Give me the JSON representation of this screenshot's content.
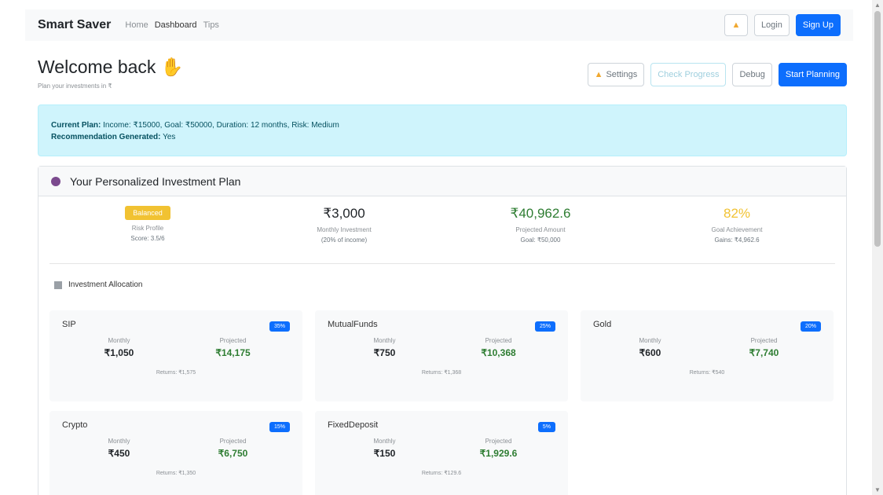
{
  "nav": {
    "brand": "Smart Saver",
    "links": [
      "Home",
      "Dashboard",
      "Tips"
    ],
    "login": "Login",
    "signup": "Sign Up"
  },
  "header": {
    "title": "Welcome back",
    "subtitle": "Plan your investments in ₹",
    "buttons": {
      "settings": "Settings",
      "check_progress": "Check Progress",
      "debug": "Debug",
      "start_planning": "Start Planning"
    }
  },
  "alert": {
    "plan_label": "Current Plan:",
    "plan_text": " Income: ₹15000, Goal: ₹50000, Duration: 12 months, Risk: Medium",
    "rec_label": "Recommendation Generated:",
    "rec_text": " Yes"
  },
  "plan": {
    "title": "Your Personalized Investment Plan",
    "stats": [
      {
        "badge": "Balanced",
        "label": "Risk Profile",
        "small": "Score: 3.5/6"
      },
      {
        "big": "₹3,000",
        "label": "Monthly Investment",
        "small": "(20% of income)"
      },
      {
        "big": "₹40,962.6",
        "label": "Projected Amount",
        "small": "Goal: ₹50,000"
      },
      {
        "big": "82%",
        "label": "Goal Achievement",
        "small": "Gains: ₹4,962.6"
      }
    ]
  },
  "allocation": {
    "title": "Investment Allocation",
    "monthly_label": "Monthly",
    "projected_label": "Projected",
    "items": [
      {
        "name": "SIP",
        "pct": "35%",
        "monthly": "₹1,050",
        "projected": "₹14,175",
        "returns": "Returns: ₹1,575"
      },
      {
        "name": "MutualFunds",
        "pct": "25%",
        "monthly": "₹750",
        "projected": "₹10,368",
        "returns": "Returns: ₹1,368"
      },
      {
        "name": "Gold",
        "pct": "20%",
        "monthly": "₹600",
        "projected": "₹7,740",
        "returns": "Returns: ₹540"
      },
      {
        "name": "Crypto",
        "pct": "15%",
        "monthly": "₹450",
        "projected": "₹6,750",
        "returns": "Returns: ₹1,350"
      },
      {
        "name": "FixedDeposit",
        "pct": "5%",
        "monthly": "₹150",
        "projected": "₹1,929.6",
        "returns": "Returns: ₹129.6"
      }
    ]
  },
  "colors": {
    "primary": "#0d6efd",
    "alert_bg": "#cff4fc",
    "badge": "#f1c232",
    "green": "#2e7d32",
    "pct_gold": "#f1c232"
  }
}
